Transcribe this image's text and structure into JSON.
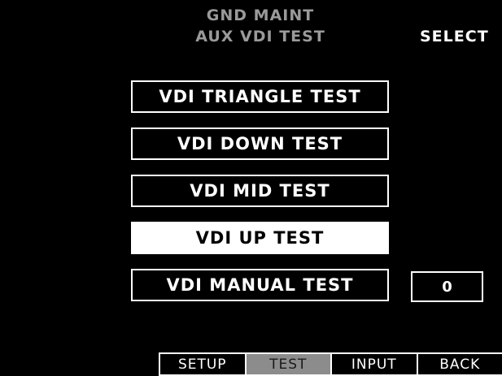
{
  "header": {
    "title_line1": "GND MAINT",
    "title_line2": "AUX VDI TEST",
    "mode_label": "SELECT"
  },
  "tests": [
    {
      "label": "VDI TRIANGLE TEST",
      "selected": false
    },
    {
      "label": "VDI DOWN TEST",
      "selected": false
    },
    {
      "label": "VDI MID TEST",
      "selected": false
    },
    {
      "label": "VDI UP TEST",
      "selected": true
    },
    {
      "label": "VDI MANUAL TEST",
      "selected": false
    }
  ],
  "manual_value": "0",
  "softkeys": [
    {
      "label": "SETUP",
      "active": false
    },
    {
      "label": "TEST",
      "active": true
    },
    {
      "label": "INPUT",
      "active": false
    },
    {
      "label": "BACK",
      "active": false
    }
  ],
  "colors": {
    "background": "#000000",
    "foreground": "#ffffff",
    "header_text": "#9a9a9a",
    "active_softkey": "#8c8c8c"
  }
}
